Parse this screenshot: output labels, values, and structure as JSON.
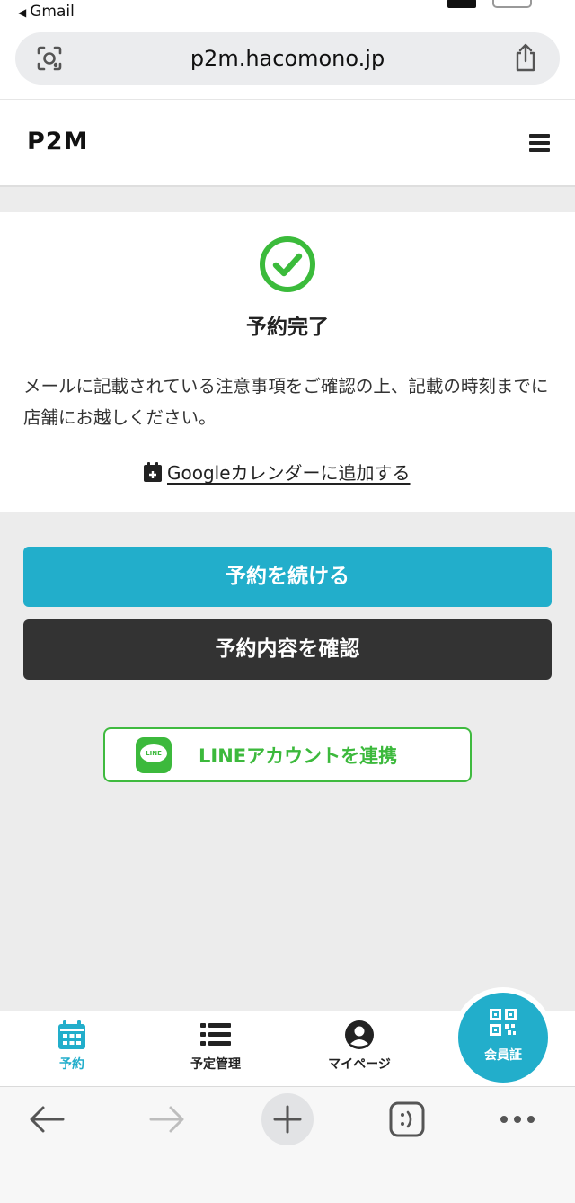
{
  "status_bar": {
    "back_app": "Gmail"
  },
  "browser": {
    "url": "p2m.hacomono.jp"
  },
  "site": {
    "logo": "P2M"
  },
  "completion": {
    "title": "予約完了",
    "message": "メールに記載されている注意事項をご確認の上、記載の時刻までに店舗にお越しください。",
    "calendar_link": "Googleカレンダーに追加する"
  },
  "actions": {
    "continue_label": "予約を続ける",
    "confirm_label": "予約内容を確認",
    "line_label": "LINEアカウントを連携",
    "line_logo_text": "LINE"
  },
  "tabbar": {
    "tabs": [
      {
        "label": "予約",
        "icon": "calendar-icon",
        "active": true
      },
      {
        "label": "予定管理",
        "icon": "list-icon",
        "active": false
      },
      {
        "label": "マイページ",
        "icon": "user-icon",
        "active": false
      }
    ],
    "member_label": "会員証",
    "member_icon": "qr-code-icon"
  },
  "colors": {
    "accent": "#22aecb",
    "dark_button": "#333333",
    "line_green": "#3cb93c",
    "success_green": "#3bbb3b"
  }
}
